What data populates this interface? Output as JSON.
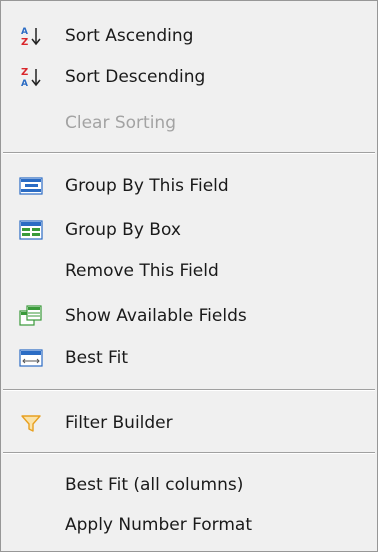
{
  "menu": {
    "items": [
      {
        "label": "Sort Ascending",
        "icon": "sort-ascending-icon",
        "enabled": true
      },
      {
        "label": "Sort Descending",
        "icon": "sort-descending-icon",
        "enabled": true
      },
      {
        "label": "Clear Sorting",
        "icon": null,
        "enabled": false
      },
      {
        "label": "Group By This Field",
        "icon": "group-by-field-icon",
        "enabled": true
      },
      {
        "label": "Group By Box",
        "icon": "group-by-box-icon",
        "enabled": true
      },
      {
        "label": "Remove This Field",
        "icon": null,
        "enabled": true
      },
      {
        "label": "Show Available Fields",
        "icon": "show-fields-icon",
        "enabled": true
      },
      {
        "label": "Best Fit",
        "icon": "best-fit-icon",
        "enabled": true
      },
      {
        "label": "Filter Builder",
        "icon": "filter-icon",
        "enabled": true
      },
      {
        "label": "Best Fit (all columns)",
        "icon": null,
        "enabled": true
      },
      {
        "label": "Apply Number Format",
        "icon": null,
        "enabled": true
      }
    ]
  },
  "colors": {
    "background": "#f0f0f0",
    "disabled_text": "#a3a3a3",
    "icon_blue": "#2b6cc4",
    "icon_red": "#d9262b",
    "icon_green": "#3a9a3a",
    "filter_orange": "#e8a020"
  }
}
